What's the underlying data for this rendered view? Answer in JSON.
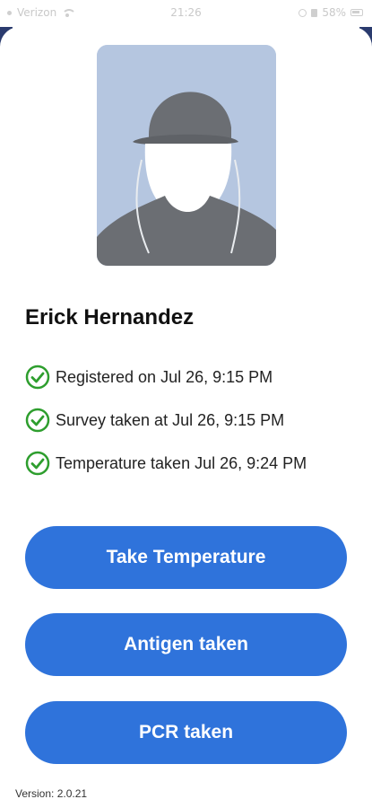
{
  "status_bar": {
    "carrier": "Verizon",
    "time": "21:26",
    "battery": "58%"
  },
  "profile": {
    "name": "Erick Hernandez",
    "avatar_icon": "person-silhouette-icon"
  },
  "statuses": [
    {
      "text": "Registered on Jul 26, 9:15 PM",
      "icon": "check-circle-icon"
    },
    {
      "text": "Survey taken at Jul 26, 9:15 PM",
      "icon": "check-circle-icon"
    },
    {
      "text": "Temperature taken Jul 26, 9:24 PM",
      "icon": "check-circle-icon"
    }
  ],
  "actions": {
    "take_temperature": "Take Temperature",
    "antigen_taken": "Antigen taken",
    "pcr_taken": "PCR taken"
  },
  "footer": {
    "version": "Version: 2.0.21"
  },
  "colors": {
    "primary": "#2f73db",
    "check": "#2e9e2e",
    "avatar_bg": "#b5c6e0"
  }
}
